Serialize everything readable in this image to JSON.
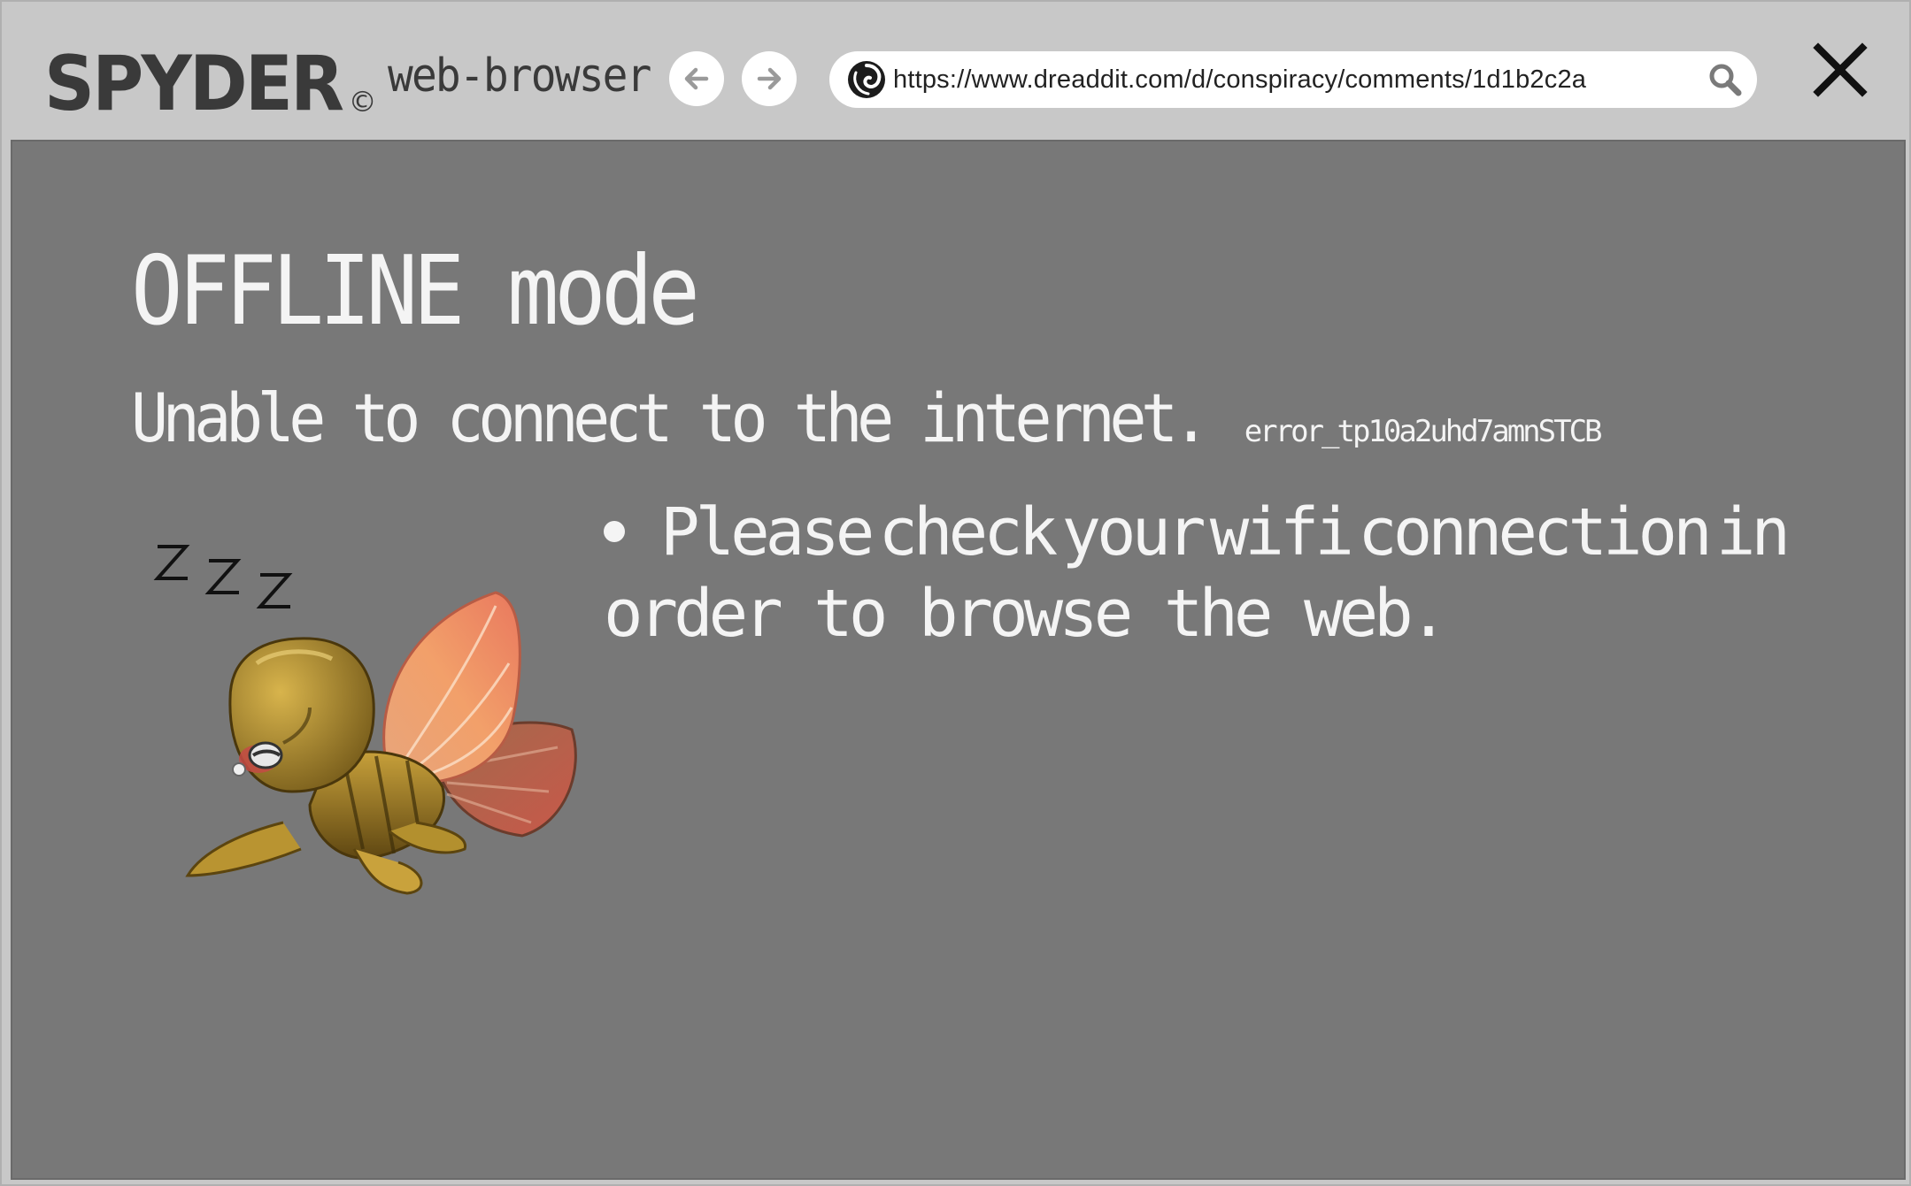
{
  "app": {
    "logo": "SPYDER",
    "logo_mark": "©",
    "subtitle": "web-browser"
  },
  "toolbar": {
    "back_icon": "arrow-left-icon",
    "forward_icon": "arrow-right-icon",
    "url": "https://www.dreaddit.com/d/conspiracy/comments/1d1b2c2a",
    "site_icon": "dreaddit-swirl-icon",
    "search_icon": "magnifier-icon",
    "close_icon": "close-x-icon"
  },
  "page": {
    "heading": "OFFLINE mode",
    "message": "Unable to connect to the internet.",
    "error_code": "error_tp10a2uhd7amnSTCB",
    "bullet_line1_words": [
      "Please",
      "check",
      "your",
      "wifi",
      "connection",
      "in"
    ],
    "bullet_line2": "order to browse the web.",
    "sleep_text": "Z Z Z",
    "illustration": "sleeping-moth-mascot"
  },
  "colors": {
    "chrome_bg": "#c8c8c8",
    "content_bg": "#787878",
    "text_light": "#f4f4f4",
    "logo_text": "#3a3a3a"
  }
}
